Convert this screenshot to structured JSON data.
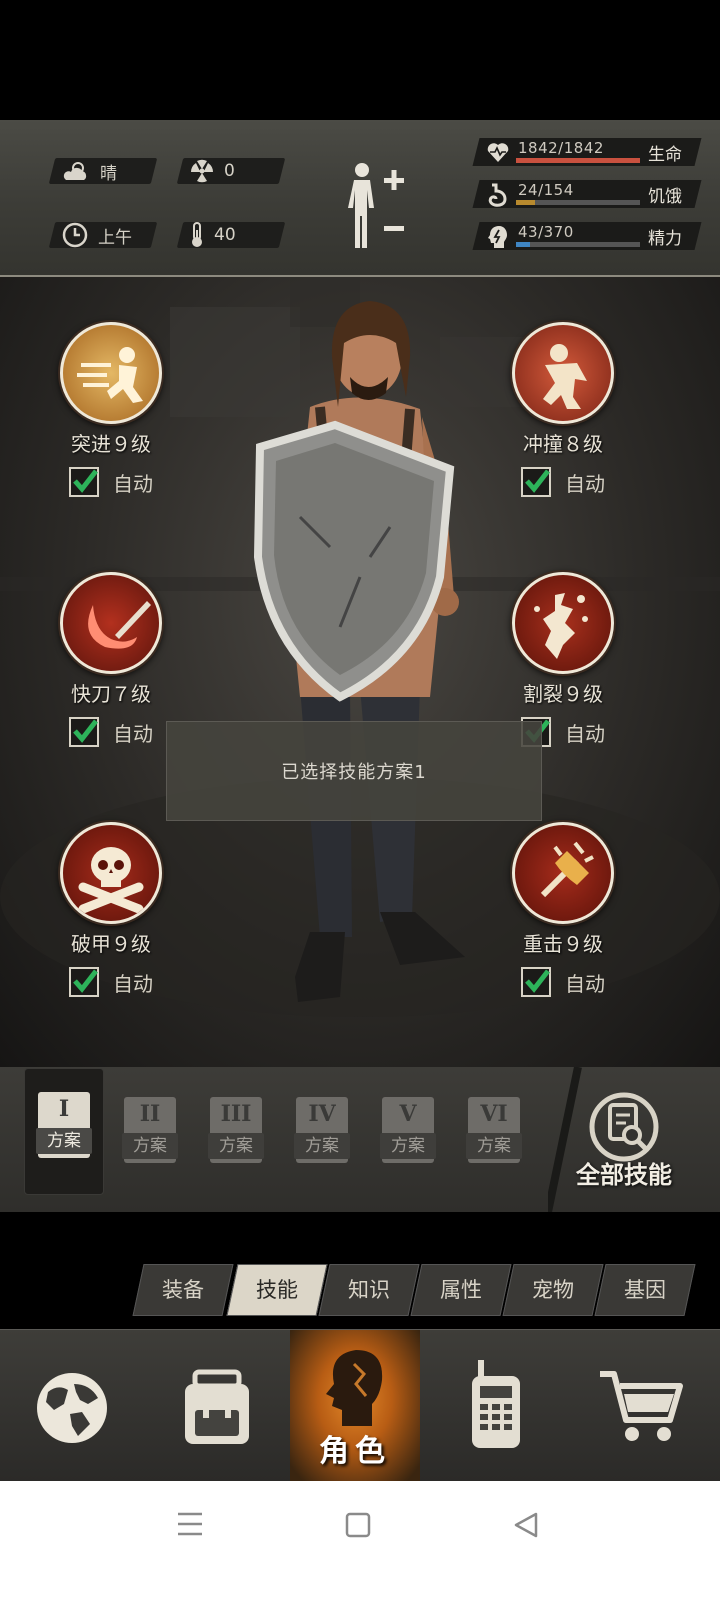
{
  "status": {
    "weather": {
      "icon": "cloud-sun-icon",
      "label": "晴"
    },
    "radiation": {
      "icon": "radiation-icon",
      "value": "0"
    },
    "time": {
      "icon": "clock-icon",
      "label": "上午"
    },
    "temperature": {
      "icon": "thermometer-icon",
      "value": "40"
    },
    "body_icon": "body-plus-minus-icon",
    "bars": [
      {
        "icon": "heart-icon",
        "value": "1842/1842",
        "label": "生命",
        "fraction": 1.0,
        "color": "#c9513f"
      },
      {
        "icon": "stomach-icon",
        "value": "24/154",
        "label": "饥饿",
        "fraction": 0.156,
        "color": "#b88a2e"
      },
      {
        "icon": "energy-head-icon",
        "value": "43/370",
        "label": "精力",
        "fraction": 0.116,
        "color": "#3f86c4"
      }
    ]
  },
  "skills": [
    {
      "name": "突进９级",
      "auto_label": "自动",
      "checked": true,
      "icon": "dash-icon"
    },
    {
      "name": "冲撞８级",
      "auto_label": "自动",
      "checked": true,
      "icon": "charge-icon"
    },
    {
      "name": "快刀７级",
      "auto_label": "自动",
      "checked": true,
      "icon": "quick-blade-icon"
    },
    {
      "name": "割裂９级",
      "auto_label": "自动",
      "checked": true,
      "icon": "rend-icon"
    },
    {
      "name": "破甲９级",
      "auto_label": "自动",
      "checked": true,
      "icon": "skull-crossbones-icon"
    },
    {
      "name": "重击９级",
      "auto_label": "自动",
      "checked": true,
      "icon": "heavy-strike-icon"
    }
  ],
  "toast": "已选择技能方案1",
  "plans": {
    "tag": "方案",
    "numerals": [
      "I",
      "II",
      "III",
      "IV",
      "V",
      "VI"
    ],
    "active_index": 0
  },
  "all_skills_label": "全部技能",
  "tabs": [
    "装备",
    "技能",
    "知识",
    "属性",
    "宠物",
    "基因"
  ],
  "active_tab": 1,
  "bottom_nav": {
    "character_label": "角色",
    "items": [
      "globe-icon",
      "backpack-icon",
      "character-head-icon",
      "radio-icon",
      "cart-icon"
    ]
  },
  "system_nav": [
    "menu-icon",
    "home-icon",
    "back-icon"
  ]
}
